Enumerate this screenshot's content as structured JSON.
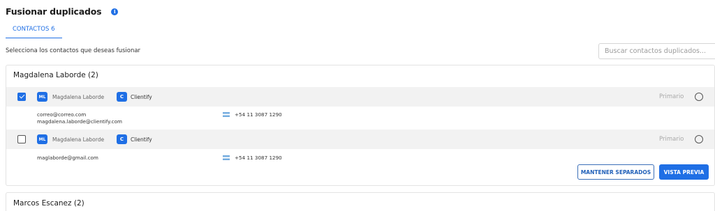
{
  "header": {
    "title": "Fusionar duplicados",
    "info_icon": "info-icon"
  },
  "tabs": [
    {
      "label": "CONTACTOS 6",
      "active": true
    }
  ],
  "subtitle": "Selecciona los contactos que deseas fusionar",
  "search": {
    "placeholder": "Buscar contactos duplicados...",
    "value": ""
  },
  "colors": {
    "accent": "#1f6fe5",
    "border": "#e3e3e3",
    "row_bg": "#f2f2f2"
  },
  "groups": [
    {
      "title": "Magdalena Laborde (2)",
      "contacts": [
        {
          "checked": true,
          "avatar": "ML",
          "name": "Magdalena Laborde",
          "company_logo": "C",
          "company": "Clientify",
          "primary_label": "Primario",
          "emails": [
            "correo@correo.com",
            "magdalena.laborde@clientify.com"
          ],
          "phone": "+54 11 3087 1290",
          "phone_flag": "argentina-flag-icon"
        },
        {
          "checked": false,
          "avatar": "ML",
          "name": "Magdalena Laborde",
          "company_logo": "C",
          "company": "Clientify",
          "primary_label": "Primario",
          "emails": [
            "maglaborde@gmail.com"
          ],
          "phone": "+54 11 3087 1290",
          "phone_flag": "argentina-flag-icon"
        }
      ],
      "actions": {
        "keep_separate": "MANTENER SEPARADOS",
        "preview": "VISTA PREVIA"
      }
    },
    {
      "title": "Marcos Escanez (2)"
    }
  ]
}
